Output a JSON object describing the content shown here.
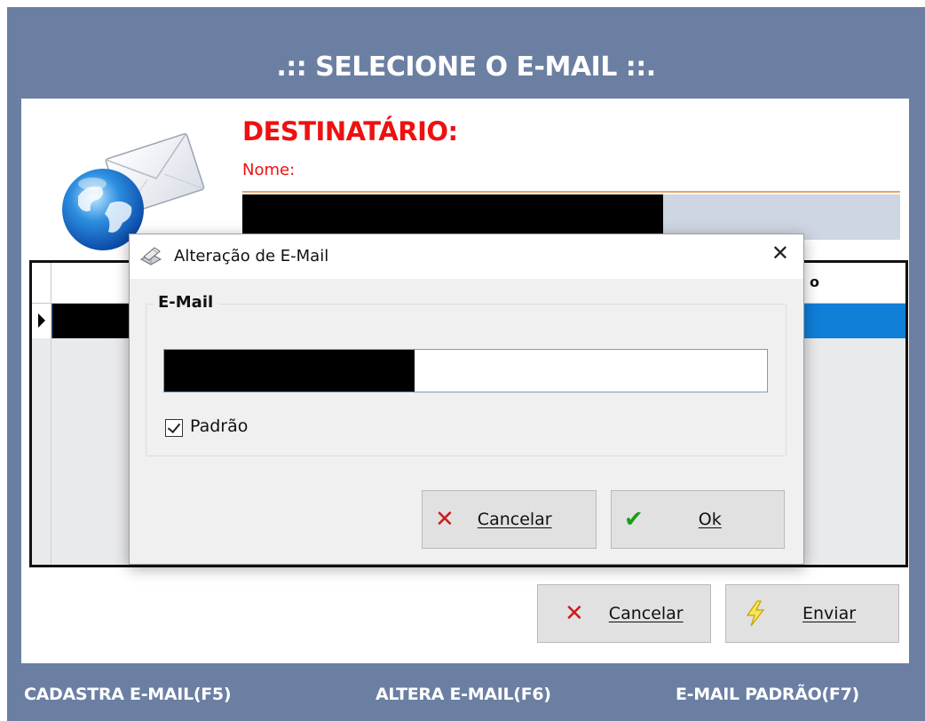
{
  "window": {
    "title": ".:: SELECIONE O E-MAIL ::.",
    "colors": {
      "frame": "#6b7fa3",
      "accent": "#ee1111",
      "selection": "#0f7fd8"
    }
  },
  "recipient": {
    "heading": "DESTINATÁRIO:",
    "name_label": "Nome:"
  },
  "grid": {
    "header_partial": "o"
  },
  "buttons": {
    "cancel_label": "Cancelar",
    "send_label": "Enviar"
  },
  "footer": {
    "register": "CADASTRA E-MAIL(F5)",
    "edit": "ALTERA E-MAIL(F6)",
    "default": "E-MAIL PADRÃO(F7)"
  },
  "dialog": {
    "title": "Alteração de E-Mail",
    "close": "✕",
    "group_label": "E-Mail",
    "checkbox_label": "Padrão",
    "checkbox_checked": true,
    "cancel_label": "Cancelar",
    "ok_label": "Ok"
  },
  "icons": {
    "cancel": "x-icon",
    "ok": "check-icon",
    "send": "lightning-icon",
    "dialog": "envelope-edit-icon",
    "header": "globe-mail-icon"
  }
}
